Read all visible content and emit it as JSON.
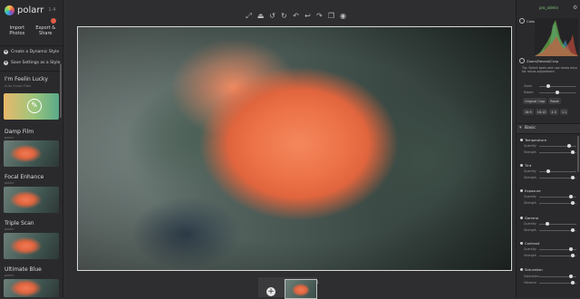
{
  "app": {
    "name": "polarr",
    "version": "1.4"
  },
  "left": {
    "import_label": "Import Photos",
    "export_label": "Export & Share",
    "create_style": "Create a Dynamic Style",
    "save_settings": "Save Settings as a Style",
    "presets": [
      {
        "name": "I'm Feelin Lucky",
        "sub": "Auto Smart Filter"
      },
      {
        "name": "Damp Film",
        "sub": "polarr"
      },
      {
        "name": "Focal Enhance",
        "sub": "polarr"
      },
      {
        "name": "Triple Scan",
        "sub": "polarr"
      },
      {
        "name": "Ultimate Blue",
        "sub": "polarr"
      }
    ]
  },
  "toolbar": [
    "crop-icon",
    "adjust-icon",
    "rotate-left-icon",
    "rotate-right-icon",
    "undo-icon",
    "undo-all-icon",
    "redo-icon",
    "compare-icon",
    "preview-eye-icon"
  ],
  "filmstrip": {
    "count": "1"
  },
  "right": {
    "user": "pro_admin",
    "histogram_label": "Color Histogram",
    "zoom_label": "Zoom/Reveal/Crop",
    "tip": "Tip: Select tools and use arrow keys for micro-adjustment",
    "zoom_slider": "Zoom",
    "rotate_slider": "Rotate",
    "straighten_slider": "Straight",
    "crop_buttons": [
      "Original Crop",
      "Reset"
    ],
    "ratios": [
      "16:9",
      "16:10",
      "4:3",
      "1:1"
    ],
    "basic_label": "Basic",
    "groups": [
      {
        "title": "Temperature",
        "s1": "Quantity",
        "s2": "Strength"
      },
      {
        "title": "Tint",
        "s1": "Quantity",
        "s2": "Strength"
      },
      {
        "title": "Exposure",
        "s1": "Quantity",
        "s2": "Strength"
      },
      {
        "title": "Gamma",
        "s1": "Quantity",
        "s2": "Strength"
      },
      {
        "title": "Contrast",
        "s1": "Quantity",
        "s2": "Strength"
      },
      {
        "title": "Saturation",
        "s1": "Saturation",
        "s2": "Vibrance"
      }
    ]
  }
}
